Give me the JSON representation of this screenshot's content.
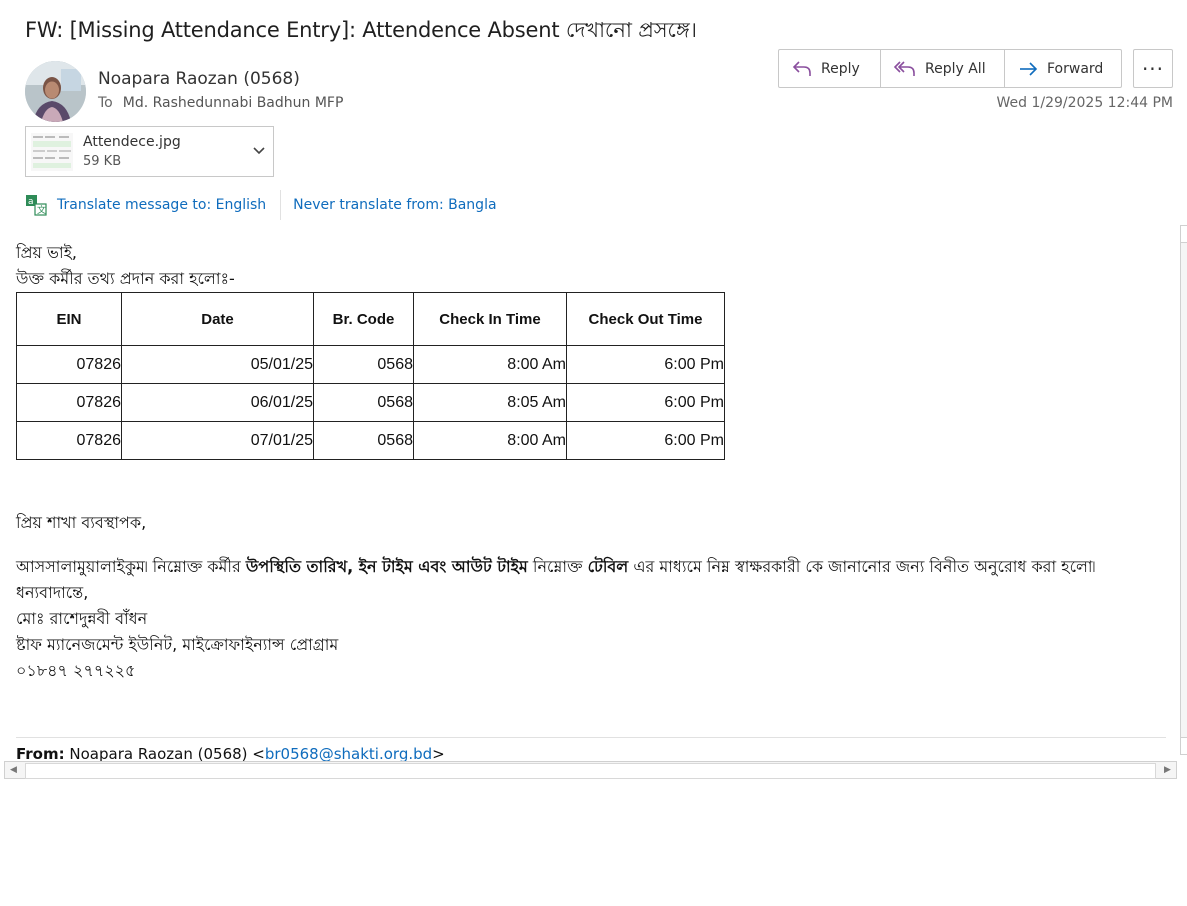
{
  "subject": "FW: [Missing Attendance Entry]: Attendence Absent দেখানো প্রসঙ্গে।",
  "sender": {
    "name": "Noapara Raozan (0568)",
    "to_label": "To",
    "to": "Md. Rashedunnabi Badhun MFP"
  },
  "actions": {
    "reply": "Reply",
    "reply_all": "Reply All",
    "forward": "Forward",
    "more": "···"
  },
  "date": "Wed 1/29/2025 12:44 PM",
  "attachment": {
    "name": "Attendece.jpg",
    "size": "59 KB"
  },
  "translate": {
    "translate_link": "Translate message to: English",
    "never_link": "Never translate from: Bangla"
  },
  "body": {
    "greeting": "প্রিয় ভাই,",
    "intro": "উক্ত কর্মীর তথ্য প্রদান করা হলোঃ-",
    "table": {
      "headers": [
        "EIN",
        "Date",
        "Br. Code",
        "Check In Time",
        "Check Out Time"
      ],
      "rows": [
        [
          "07826",
          "05/01/25",
          "0568",
          "8:00 Am",
          "6:00 Pm"
        ],
        [
          "07826",
          "06/01/25",
          "0568",
          "8:05 Am",
          "6:00 Pm"
        ],
        [
          "07826",
          "07/01/25",
          "0568",
          "8:00 Am",
          "6:00 Pm"
        ]
      ]
    },
    "salutation": "প্রিয় শাখা ব্যবস্থাপক,",
    "para_1": "আসসালামুয়ালাইকুম৷ নিম্নোক্ত কর্মীর",
    "para_bold_1": "উপস্থিতি তারিখ, ইন টাইম এবং আউট টাইম",
    "para_2": "নিম্নোক্ত",
    "para_bold_2": "টেবিল",
    "para_3": "এর মাধ্যমে নিম্ন স্বাক্ষরকারী কে জানানোর জন্য বিনীত অনুরোধ করা হলো৷",
    "thanks": "ধন্যবাদান্তে,",
    "sig_name": "মোঃ রাশেদুন্নবী বাঁধন",
    "sig_unit": "ষ্টাফ ম্যানেজমেন্ট ইউনিট, মাইক্রোফাইন্যান্স প্রোগ্রাম",
    "sig_phone": "০১৮৪৭ ২৭৭২২৫"
  },
  "forward_header": {
    "from_label": "From:",
    "from_name": "Noapara Raozan (0568) <",
    "from_email": "br0568@shakti.org.bd",
    "from_close": ">"
  }
}
